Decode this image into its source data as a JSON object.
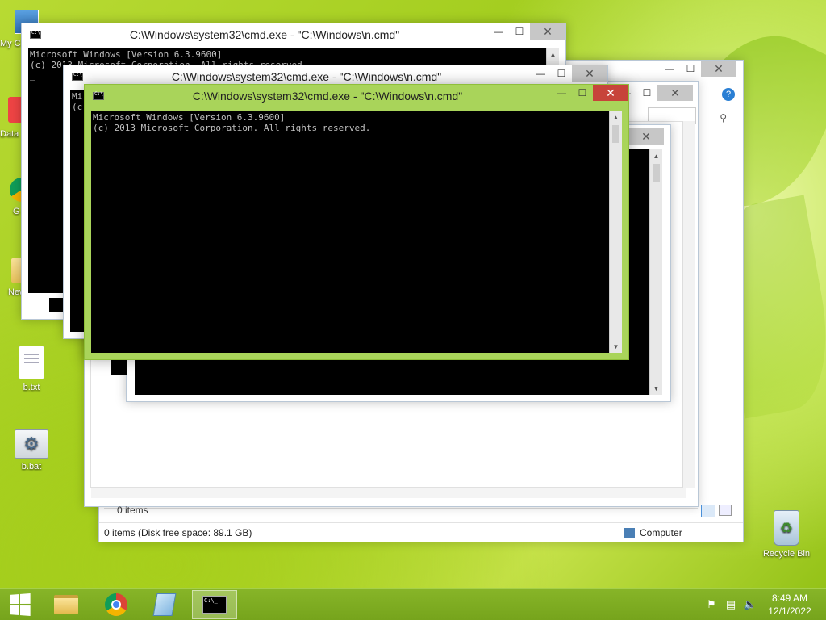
{
  "desktop": {
    "icons": [
      {
        "label": "My C"
      },
      {
        "label": "Data"
      },
      {
        "label": "G"
      },
      {
        "label": "New fol"
      },
      {
        "label": "b.txt"
      },
      {
        "label": "b.bat"
      },
      {
        "label": "Recycle Bin"
      }
    ]
  },
  "cmd_windows": [
    {
      "title": "C:\\Windows\\system32\\cmd.exe - \"C:\\Windows\\n.cmd\"",
      "lines": [
        "Microsoft Windows [Version 6.3.9600]",
        "(c) 2013 Microsoft Corporation. All rights reserved.",
        "_"
      ]
    },
    {
      "title": "C:\\Windows\\system32\\cmd.exe - \"C:\\Windows\\n.cmd\"",
      "lines": [
        "Mi",
        "(c"
      ]
    },
    {
      "title": "C:\\Windows\\system32\\cmd.exe - \"C:\\Windows\\n.cmd\"",
      "lines": [
        "Microsoft Windows [Version 6.3.9600]",
        "(c) 2013 Microsoft Corporation. All rights reserved."
      ]
    }
  ],
  "explorer": {
    "items_count": "0 items",
    "status_left": "0 items (Disk free space: 89.1 GB)",
    "status_right": "Computer"
  },
  "window_controls": {
    "minimize": "—",
    "maximize": "☐",
    "close": "✕"
  },
  "taskbar": {
    "buttons": [
      {
        "icon": "windows-start-icon"
      },
      {
        "icon": "file-explorer-icon"
      },
      {
        "icon": "chrome-icon"
      },
      {
        "icon": "notepad-icon"
      },
      {
        "icon": "cmd-icon"
      }
    ],
    "clock_time": "8:49 AM",
    "clock_date": "12/1/2022"
  },
  "colors": {
    "active_frame": "#a9d45a",
    "close_active": "#c7443a",
    "taskbar": "#7fad22"
  }
}
